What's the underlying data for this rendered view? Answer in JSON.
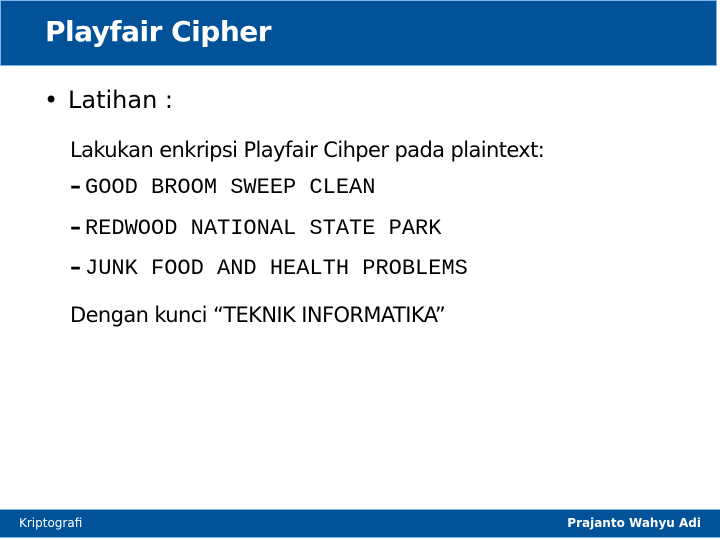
{
  "slide": {
    "title": "Playfair Cipher",
    "bullet": "Latihan :",
    "bullet_glyph": "•",
    "instruction": "Lakukan enkripsi Playfair Cihper pada plaintext:",
    "dash_glyph": "–",
    "plaintexts": [
      "GOOD BROOM SWEEP CLEAN",
      "REDWOOD NATIONAL STATE PARK",
      "JUNK FOOD AND HEALTH PROBLEMS"
    ],
    "key_line": "Dengan kunci “TEKNIK INFORMATIKA”"
  },
  "footer": {
    "left": "Kriptografi",
    "right": "Prajanto Wahyu Adi"
  },
  "colors": {
    "brand_blue": "#02529a",
    "border_light_blue": "#7fb6e6"
  }
}
